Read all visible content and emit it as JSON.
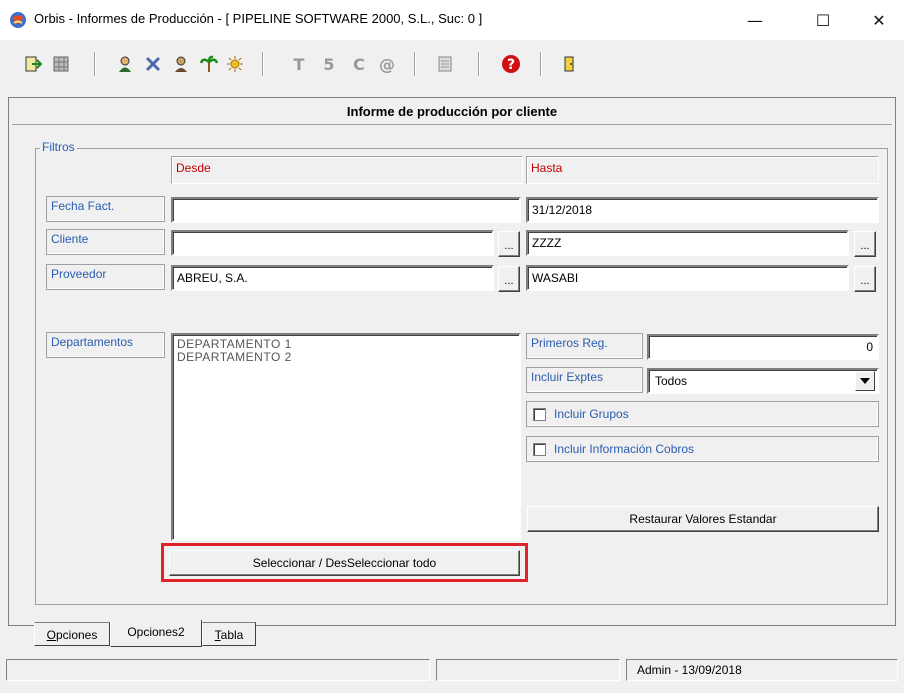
{
  "window": {
    "title": "Orbis - Informes de Producción - [ PIPELINE SOFTWARE 2000, S.L.,  Suc: 0 ]",
    "minimize": "—",
    "maximize": "☐",
    "close": "✕"
  },
  "toolbar": {
    "icons": [
      "exit-icon",
      "grid-icon",
      "user-icon",
      "tools-icon",
      "worker-icon",
      "palm-icon",
      "sun-icon",
      "t-icon",
      "five-icon",
      "c-icon",
      "at-icon",
      "form-icon",
      "help-icon",
      "door-icon"
    ],
    "glyphs": {
      "t": "T",
      "five": "5",
      "c": "C",
      "at": "@",
      "help": "?"
    }
  },
  "report": {
    "title": "Informe de producción por cliente"
  },
  "filters": {
    "label": "Filtros",
    "desde_header": "Desde",
    "hasta_header": "Hasta",
    "rows": [
      {
        "label": "Fecha Fact.",
        "desde": "",
        "hasta": "31/12/2018"
      },
      {
        "label": "Cliente",
        "desde": "",
        "hasta": "ZZZZ"
      },
      {
        "label": "Proveedor",
        "desde": "ABREU, S.A.",
        "hasta": "WASABI"
      }
    ],
    "dots": "...",
    "departamentos_label": "Departamentos",
    "departamentos": [
      "DEPARTAMENTO 1",
      "DEPARTAMENTO 2"
    ],
    "select_all_button": "Seleccionar / DesSeleccionar todo",
    "primeros_reg_label": "Primeros Reg.",
    "primeros_reg_value": "0",
    "incluir_exptes_label": "Incluir Exptes",
    "incluir_exptes_value": "Todos",
    "incluir_grupos": "Incluir Grupos",
    "incluir_cobros": "Incluir Información Cobros",
    "restore_button": "Restaurar Valores Estandar"
  },
  "tabs": [
    {
      "label": "Opciones",
      "underline": "O",
      "rest": "pciones"
    },
    {
      "label": "Opciones2",
      "underline": "",
      "rest": "Opciones2"
    },
    {
      "label": "Tabla",
      "underline": "T",
      "rest": "abla"
    }
  ],
  "status": {
    "user_date": "Admin - 13/09/2018"
  },
  "colors": {
    "accent_label": "#2a5cb0",
    "header_red": "#c00000",
    "highlight": "#e0222a"
  }
}
